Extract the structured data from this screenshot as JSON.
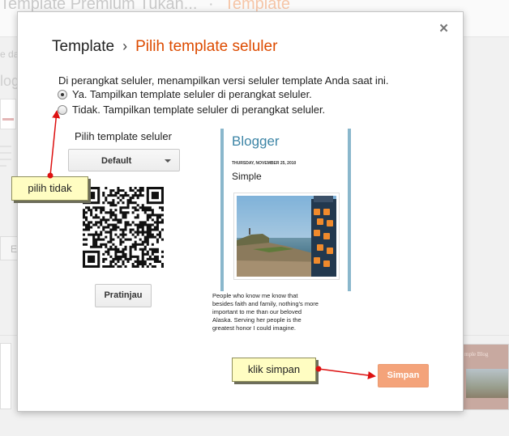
{
  "background": {
    "title": "Template Premium Tukan...",
    "breadcrumb_sep": "·",
    "breadcrumb_current": "Template",
    "side_text": "e da",
    "side_blog": "log",
    "side_button": "E",
    "card_title": "mple Blog"
  },
  "dialog": {
    "close_label": "×",
    "breadcrumb": {
      "parent": "Template",
      "separator": "›",
      "current": "Pilih template seluler"
    },
    "description": "Di perangkat seluler, menampilkan versi seluler template Anda saat ini.",
    "options": [
      {
        "label": "Ya. Tampilkan template seluler di perangkat seluler.",
        "checked": true
      },
      {
        "label": "Tidak. Tampilkan template seluler di perangkat seluler.",
        "checked": false
      }
    ],
    "mobile_template_label": "Pilih template seluler",
    "template_select": {
      "value": "Default"
    },
    "preview_button": "Pratinjau",
    "save_button": "Simpan",
    "preview": {
      "blog_title": "Blogger",
      "date": "THURSDAY, NOVEMBER 25, 2010",
      "post_title": "Simple",
      "body_lines": [
        "People who know me know that",
        "besides faith and family, nothing's more",
        "important to me than our beloved",
        "Alaska. Serving her people is the",
        "greatest honor I could imagine."
      ]
    }
  },
  "annotations": {
    "tidak": "pilih tidak",
    "simpan": "klik simpan"
  },
  "colors": {
    "accent": "#dd4b00",
    "save_button": "#f4a37a",
    "callout_bg": "#fffdc2",
    "arrow": "#dd1111",
    "preview_border": "#8ab7cc"
  }
}
